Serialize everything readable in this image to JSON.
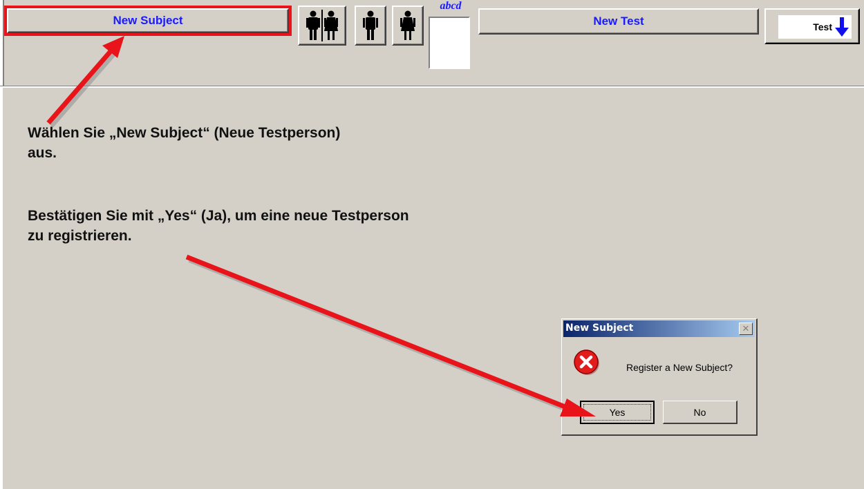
{
  "toolbar": {
    "new_subject_label": "New Subject",
    "abcd_label": "abcd",
    "new_test_label": "New Test",
    "test_label": "Test"
  },
  "instructions": {
    "line1": "Wählen Sie „New Subject“ (Neue Testperson) aus.",
    "line2": "Bestätigen Sie mit „Yes“ (Ja), um eine neue Testperson zu registrieren."
  },
  "dialog": {
    "title": "New Subject",
    "close_glyph": "✕",
    "message": "Register a New Subject?",
    "yes_label": "Yes",
    "no_label": "No"
  },
  "colors": {
    "accent_blue": "#1a1aff",
    "annotation_red": "#e8141a",
    "background": "#d4d0c8",
    "title_bar": "#0a246a"
  },
  "icons": [
    "couple-icon",
    "male-icon",
    "female-icon",
    "arrow-down-icon",
    "error-icon"
  ]
}
